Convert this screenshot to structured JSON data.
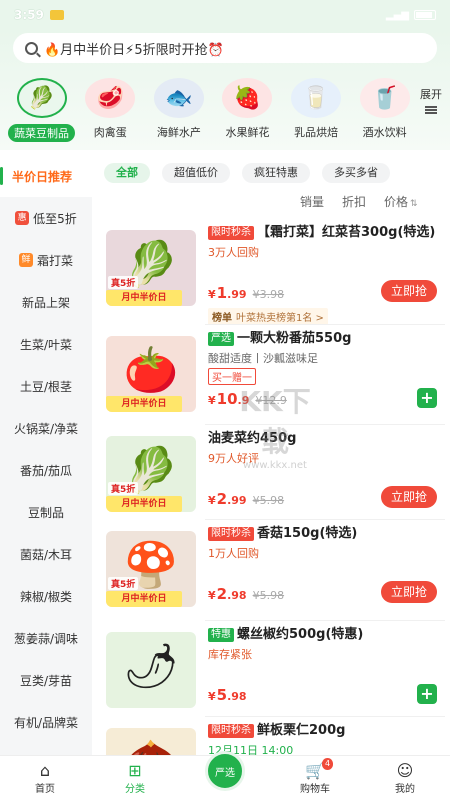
{
  "status_bar": {
    "time": "3:59"
  },
  "search": {
    "text": "🔥月中半价日⚡5折限时开抢⏰"
  },
  "categories": [
    {
      "label": "蔬菜豆制品",
      "icon": "🥬",
      "bg": "#dff3e2"
    },
    {
      "label": "肉禽蛋",
      "icon": "🥩",
      "bg": "#fde3e3"
    },
    {
      "label": "海鲜水产",
      "icon": "🐟",
      "bg": "#e4ebf5"
    },
    {
      "label": "水果鲜花",
      "icon": "🍓",
      "bg": "#fde4e4"
    },
    {
      "label": "乳品烘焙",
      "icon": "🥛",
      "bg": "#e6f0fb"
    },
    {
      "label": "酒水饮料",
      "icon": "🥤",
      "bg": "#fdeaea"
    }
  ],
  "expand_label": "展开",
  "sidebar": [
    {
      "label": "半价日推荐",
      "badge": ""
    },
    {
      "label": "低至5折",
      "badge": "惠"
    },
    {
      "label": "霜打菜",
      "badge": "鲜"
    },
    {
      "label": "新品上架",
      "badge": ""
    },
    {
      "label": "生菜/叶菜",
      "badge": ""
    },
    {
      "label": "土豆/根茎",
      "badge": ""
    },
    {
      "label": "火锅菜/净菜",
      "badge": ""
    },
    {
      "label": "番茄/茄瓜",
      "badge": ""
    },
    {
      "label": "豆制品",
      "badge": ""
    },
    {
      "label": "菌菇/木耳",
      "badge": ""
    },
    {
      "label": "辣椒/椒类",
      "badge": ""
    },
    {
      "label": "葱姜蒜/调味",
      "badge": ""
    },
    {
      "label": "豆类/芽苗",
      "badge": ""
    },
    {
      "label": "有机/品牌菜",
      "badge": ""
    }
  ],
  "chips": [
    "全部",
    "超值低价",
    "疯狂特惠",
    "多买多省"
  ],
  "sorts": [
    "销量",
    "折扣",
    "价格"
  ],
  "products": [
    {
      "tag": "限时秒杀",
      "tag_color": "red",
      "title": "【霜打菜】红菜苔300g(特选)",
      "sub": "3万人回购",
      "sub_style": "orange",
      "price_int": "1",
      "price_dec": ".99",
      "old": "¥3.98",
      "button": "立即抢",
      "rank_tag": "榜单",
      "rank_text": "叶菜热卖榜第1名 >",
      "img_bg": "#e9d8dc",
      "img_icon": "🥬",
      "img_badge": "月中半价日",
      "img_half": "真5折"
    },
    {
      "tag": "严选",
      "tag_color": "green",
      "title": "一颗大粉番茄550g",
      "sub": "酸甜适度丨沙瓤滋味足",
      "sub_style": "grey",
      "price_int": "10",
      "price_dec": ".9",
      "old": "¥12.9",
      "button": "+",
      "promo": "买一赠一",
      "img_bg": "#f6e0d8",
      "img_icon": "🍅",
      "img_badge": "月中半价日",
      "img_half": ""
    },
    {
      "tag": "",
      "tag_color": "",
      "title": "油麦菜约450g",
      "sub": "9万人好评",
      "sub_style": "orange",
      "price_int": "2",
      "price_dec": ".99",
      "old": "¥5.98",
      "button": "立即抢",
      "img_bg": "#e5f2df",
      "img_icon": "🥬",
      "img_badge": "月中半价日",
      "img_half": "真5折"
    },
    {
      "tag": "限时秒杀",
      "tag_color": "red",
      "title": "香菇150g(特选)",
      "sub": "1万人回购",
      "sub_style": "orange",
      "price_int": "2",
      "price_dec": ".98",
      "old": "¥5.98",
      "button": "立即抢",
      "img_bg": "#efe3da",
      "img_icon": "🍄",
      "img_badge": "月中半价日",
      "img_half": "真5折"
    },
    {
      "tag": "特惠",
      "tag_color": "green",
      "title": "螺丝椒约500g(特惠)",
      "sub": "库存紧张",
      "sub_style": "orange",
      "price_int": "5",
      "price_dec": ".98",
      "old": "",
      "button": "+",
      "img_bg": "#e6f3e0",
      "img_icon": "🌶",
      "img_badge": "",
      "img_half": ""
    },
    {
      "tag": "限时秒杀",
      "tag_color": "red",
      "title": "鲜板栗仁200g",
      "sub": "12月11日 14:00",
      "sub_style": "green",
      "price_int": "",
      "price_dec": "",
      "old": "",
      "button": "",
      "img_bg": "#f6ecd6",
      "img_icon": "🌰",
      "img_badge": "",
      "img_half": ""
    }
  ],
  "watermark": {
    "logo": "KK下载",
    "url": "www.kkx.net"
  },
  "bottom_nav": [
    {
      "label": "首页",
      "icon": "⌂"
    },
    {
      "label": "分类",
      "icon": "⊞"
    },
    {
      "label": "严选",
      "icon": ""
    },
    {
      "label": "购物车",
      "icon": "🛒",
      "badge": "4"
    },
    {
      "label": "我的",
      "icon": "☺"
    }
  ]
}
